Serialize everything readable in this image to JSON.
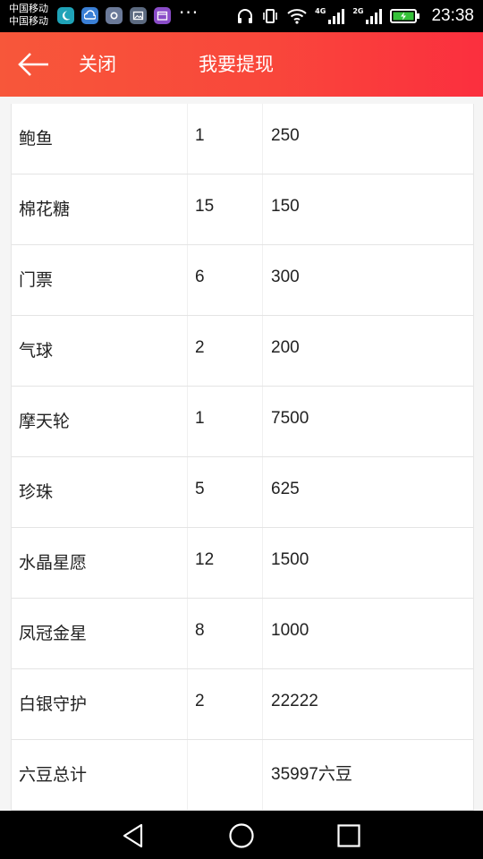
{
  "status_bar": {
    "carrier_line1": "中国移动",
    "carrier_line2": "中国移动",
    "more": "···",
    "net1": "4G",
    "net2": "2G",
    "time": "23:38"
  },
  "header": {
    "close_label": "关闭",
    "title": "我要提现",
    "background": "#f9473b"
  },
  "table": {
    "rows": [
      {
        "name": "鲍鱼",
        "count": "1",
        "value": "250"
      },
      {
        "name": "棉花糖",
        "count": "15",
        "value": "150"
      },
      {
        "name": "门票",
        "count": "6",
        "value": "300"
      },
      {
        "name": "气球",
        "count": "2",
        "value": "200"
      },
      {
        "name": "摩天轮",
        "count": "1",
        "value": "7500"
      },
      {
        "name": "珍珠",
        "count": "5",
        "value": "625"
      },
      {
        "name": "水晶星愿",
        "count": "12",
        "value": "1500"
      },
      {
        "name": "凤冠金星",
        "count": "8",
        "value": "1000"
      },
      {
        "name": "白银守护",
        "count": "2",
        "value": "22222"
      }
    ],
    "total": {
      "label": "六豆总计",
      "value": "35997六豆"
    }
  },
  "icons": {
    "back": "back-arrow-icon",
    "nav_back": "triangle-back-icon",
    "nav_home": "circle-home-icon",
    "nav_recent": "square-recent-icon"
  }
}
